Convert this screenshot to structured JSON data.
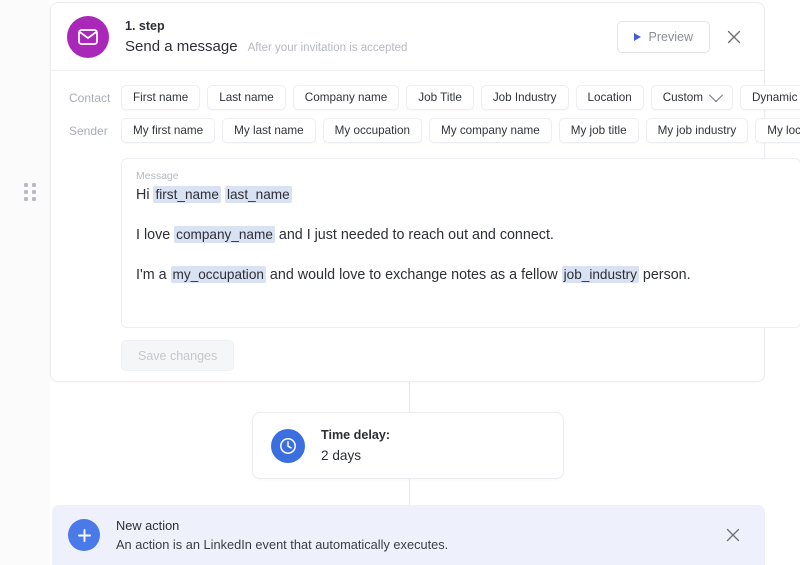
{
  "step": {
    "icon": "envelope-icon",
    "icon_color": "#a927b9",
    "number_label": "1. step",
    "title": "Send a message",
    "subtitle": "After your invitation is accepted",
    "preview_label": "Preview",
    "preview_icon": "play-icon",
    "close_icon": "close-icon"
  },
  "variables": {
    "contact": {
      "label": "Contact",
      "chips": [
        {
          "label": "First name",
          "dropdown": false
        },
        {
          "label": "Last name",
          "dropdown": false
        },
        {
          "label": "Company name",
          "dropdown": false
        },
        {
          "label": "Job Title",
          "dropdown": false
        },
        {
          "label": "Job Industry",
          "dropdown": false
        },
        {
          "label": "Location",
          "dropdown": false
        },
        {
          "label": "Custom",
          "dropdown": true
        },
        {
          "label": "Dynamic",
          "dropdown": true
        }
      ]
    },
    "sender": {
      "label": "Sender",
      "chips": [
        {
          "label": "My first name",
          "dropdown": false
        },
        {
          "label": "My last name",
          "dropdown": false
        },
        {
          "label": "My occupation",
          "dropdown": false
        },
        {
          "label": "My company name",
          "dropdown": false
        },
        {
          "label": "My job title",
          "dropdown": false
        },
        {
          "label": "My job industry",
          "dropdown": false
        },
        {
          "label": "My location",
          "dropdown": false
        }
      ]
    }
  },
  "message": {
    "field_label": "Message",
    "token_color": "#d9e2f3",
    "lines": [
      [
        {
          "type": "text",
          "value": "Hi "
        },
        {
          "type": "token",
          "value": "first_name"
        },
        {
          "type": "text",
          "value": " "
        },
        {
          "type": "token",
          "value": "last_name"
        }
      ],
      [
        {
          "type": "text",
          "value": "I love "
        },
        {
          "type": "token",
          "value": "company_name"
        },
        {
          "type": "text",
          "value": " and I just needed to reach out and connect."
        }
      ],
      [
        {
          "type": "text",
          "value": "I'm a "
        },
        {
          "type": "token",
          "value": "my_occupation"
        },
        {
          "type": "text",
          "value": " and would love to exchange notes as a fellow "
        },
        {
          "type": "token",
          "value": "job_industry"
        },
        {
          "type": "text",
          "value": " person."
        }
      ]
    ]
  },
  "save": {
    "label": "Save changes",
    "disabled": true
  },
  "time_delay": {
    "icon": "clock-icon",
    "icon_color": "#3b6fe0",
    "title": "Time delay:",
    "value": "2 days"
  },
  "new_action": {
    "icon": "plus-icon",
    "icon_color": "#4a7ae8",
    "background": "#eef1fb",
    "title": "New action",
    "subtitle": "An action is an LinkedIn event that automatically executes.",
    "close_icon": "close-icon"
  }
}
